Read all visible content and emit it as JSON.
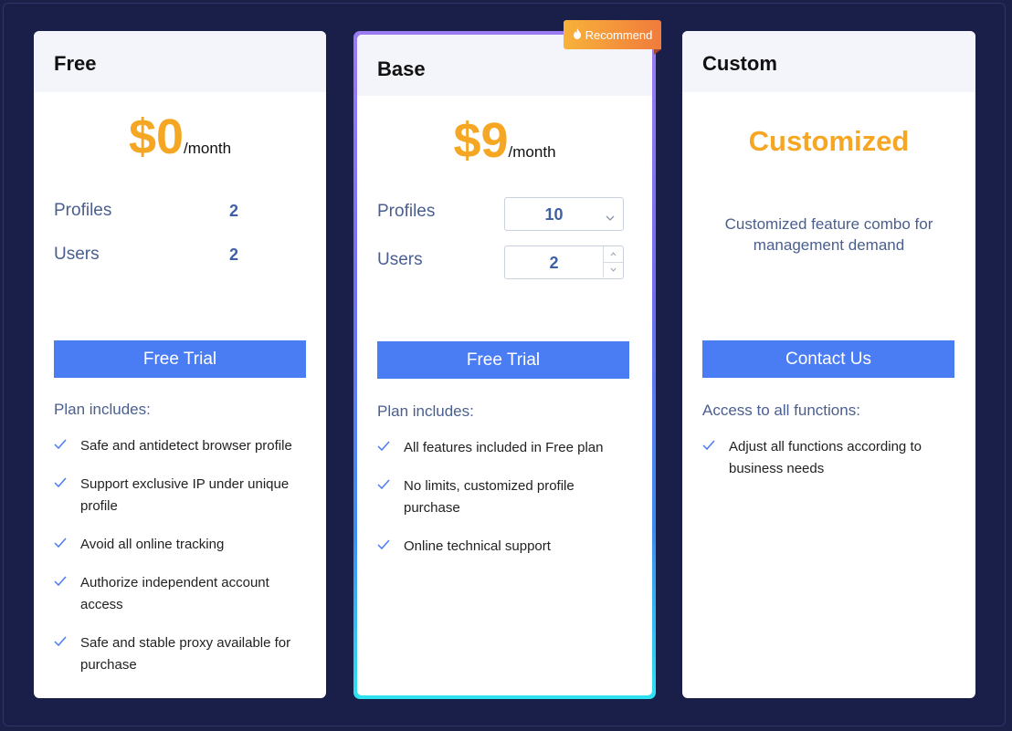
{
  "badge": {
    "label": "Recommend",
    "icon": "flame-icon"
  },
  "plans": {
    "free": {
      "title": "Free",
      "price": "$0",
      "per": "/month",
      "profiles_label": "Profiles",
      "profiles_value": "2",
      "users_label": "Users",
      "users_value": "2",
      "cta": "Free Trial",
      "includes_label": "Plan includes:",
      "features": [
        "Safe and antidetect browser profile",
        "Support exclusive IP under unique profile",
        "Avoid all online tracking",
        "Authorize independent account access",
        "Safe and stable proxy available for purchase"
      ]
    },
    "base": {
      "title": "Base",
      "price": "$9",
      "per": "/month",
      "profiles_label": "Profiles",
      "profiles_value": "10",
      "users_label": "Users",
      "users_value": "2",
      "cta": "Free Trial",
      "includes_label": "Plan includes:",
      "features": [
        "All features included in Free plan",
        "No limits, customized profile purchase",
        "Online technical support"
      ]
    },
    "custom": {
      "title": "Custom",
      "headline": "Customized",
      "description": "Customized feature combo for management demand",
      "cta": "Contact Us",
      "includes_label": "Access to all functions:",
      "features": [
        "Adjust all functions according to business needs"
      ]
    }
  },
  "colors": {
    "accent": "#4a7cf4",
    "price": "#f5a623",
    "background": "#1b2048",
    "badge_start": "#f8b23a",
    "badge_end": "#f07b3c"
  }
}
